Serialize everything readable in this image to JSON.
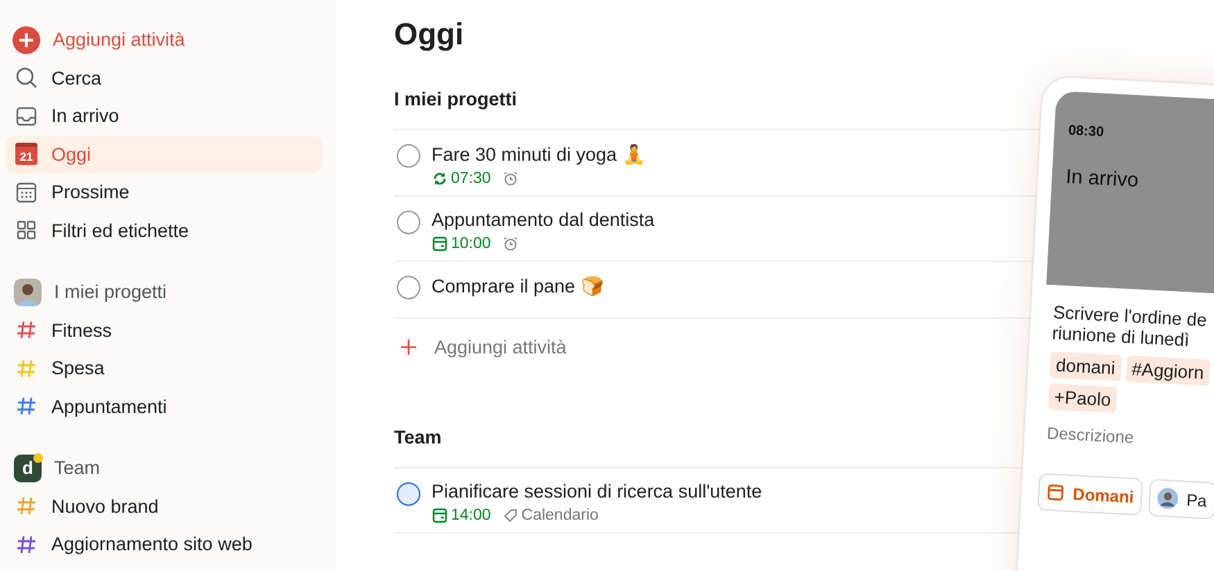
{
  "sidebar": {
    "add_task": {
      "label": "Aggiungi attività"
    },
    "nav": [
      {
        "label": "Cerca",
        "kind": "search",
        "selected": false
      },
      {
        "label": "In arrivo",
        "kind": "inbox",
        "selected": false
      },
      {
        "label": "Oggi",
        "kind": "today",
        "badge": "21",
        "selected": true
      },
      {
        "label": "Prossime",
        "kind": "upcoming",
        "selected": false
      },
      {
        "label": "Filtri ed etichette",
        "kind": "filters",
        "selected": false
      }
    ],
    "groups": [
      {
        "title": "I miei progetti",
        "kind": "person",
        "projects": [
          {
            "label": "Fitness",
            "color": "#e05252"
          },
          {
            "label": "Spesa",
            "color": "#f5c518"
          },
          {
            "label": "Appuntamenti",
            "color": "#3f7bf0"
          }
        ]
      },
      {
        "title": "Team",
        "kind": "letter",
        "avatar_letter": "d",
        "projects": [
          {
            "label": "Nuovo brand",
            "color": "#f0a030"
          },
          {
            "label": "Aggiornamento sito web",
            "color": "#7a4fd6"
          }
        ]
      }
    ]
  },
  "main": {
    "title": "Oggi",
    "sections": [
      {
        "title": "I miei progetti",
        "add_task": "Aggiungi attività",
        "tasks": [
          {
            "text": "Fare 30 minuti di yoga",
            "emoji": "🧘",
            "color": "#999999",
            "due": {
              "kind": "recurring",
              "time": "07:30"
            },
            "alarm": true
          },
          {
            "text": "Appuntamento dal dentista",
            "color": "#999999",
            "due": {
              "kind": "date",
              "time": "10:00"
            },
            "alarm": true
          },
          {
            "text": "Comprare il pane",
            "emoji": "🍞",
            "color": "#999999"
          }
        ]
      },
      {
        "title": "Team",
        "tasks": [
          {
            "text": "Pianificare sessioni di ricerca sull'utente",
            "color": "#246fe0",
            "due": {
              "kind": "date",
              "time": "14:00"
            },
            "alarm": false,
            "label": "Calendario"
          }
        ]
      }
    ]
  },
  "phone": {
    "time": "08:30",
    "title": "In arrivo",
    "task_lines": [
      "Scrivere l'ordine de",
      "riunione di lunedì"
    ],
    "tags": [
      "domani",
      "#Aggiorn",
      "+Paolo"
    ],
    "description_placeholder": "Descrizione",
    "buttons": [
      {
        "label": "Domani",
        "kind": "calendar"
      },
      {
        "label": "Pa",
        "kind": "avatar"
      }
    ]
  }
}
